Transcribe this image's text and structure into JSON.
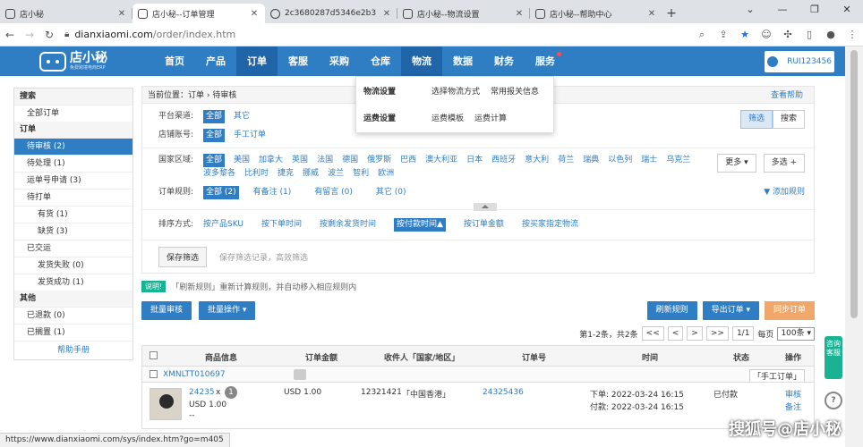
{
  "browser": {
    "tabs": [
      {
        "title": "店小秘",
        "active": false
      },
      {
        "title": "店小秘--订单管理",
        "active": true
      },
      {
        "title": "2c3680287d5346e2b3",
        "active": false
      },
      {
        "title": "店小秘--物流设置",
        "active": false
      },
      {
        "title": "店小秘--帮助中心",
        "active": false
      }
    ],
    "new_tab": "+",
    "url_host": "dianxiaomi.com",
    "url_path": "/order/index.htm",
    "status_url": "https://www.dianxiaomi.com/sys/index.htm?go=m405"
  },
  "app": {
    "logo_name": "店小秘",
    "logo_sub": "免费跨境电商ERP",
    "menu": [
      "首页",
      "产品",
      "订单",
      "客服",
      "采购",
      "仓库",
      "物流",
      "数据",
      "财务",
      "服务"
    ],
    "user": "RUI123456",
    "logistics_dropdown": {
      "rows": [
        {
          "title": "物流设置",
          "items": [
            "选择物流方式",
            "常用报关信息"
          ]
        },
        {
          "title": "运费设置",
          "items": [
            "运费模板",
            "运费计算"
          ]
        }
      ]
    }
  },
  "sidebar": {
    "search_header": "搜索",
    "all_orders": "全部订单",
    "order_header": "订单",
    "items": [
      {
        "label": "待审核  (2)",
        "selected": true,
        "sub": false
      },
      {
        "label": "待处理  (1)",
        "selected": false,
        "sub": false
      },
      {
        "label": "运单号申请  (3)",
        "selected": false,
        "sub": false
      },
      {
        "label": "待打单",
        "selected": false,
        "sub": false
      },
      {
        "label": "有货  (1)",
        "selected": false,
        "sub": true
      },
      {
        "label": "缺货  (3)",
        "selected": false,
        "sub": true
      },
      {
        "label": "已交运",
        "selected": false,
        "sub": false
      },
      {
        "label": "发货失败  (0)",
        "selected": false,
        "sub": true
      },
      {
        "label": "发货成功  (1)",
        "selected": false,
        "sub": true
      }
    ],
    "other_header": "其他",
    "other_items": [
      "已退款  (0)",
      "已搁置  (1)"
    ],
    "help": "帮助手册"
  },
  "main": {
    "breadcrumb": "当前位置：订单 › 待审核",
    "help_link": "查看帮助",
    "filters": {
      "platform_label": "平台渠道:",
      "platform_opts": [
        "全部",
        "其它"
      ],
      "shop_label": "店铺账号:",
      "shop_opts": [
        "全部",
        "手工订单"
      ],
      "country_label": "国家区域:",
      "country_opts": [
        "全部",
        "美国",
        "加拿大",
        "英国",
        "法国",
        "德国",
        "俄罗斯",
        "巴西",
        "澳大利亚",
        "日本",
        "西班牙",
        "意大利",
        "荷兰",
        "瑞典",
        "以色列",
        "瑞士",
        "乌克兰",
        "波多黎各",
        "比利时",
        "捷克",
        "挪威",
        "波兰",
        "智利",
        "欧洲"
      ],
      "rule_label": "订单规则:",
      "rule_opts": [
        "全部 (2)",
        "有备注 (1)",
        "有留言 (0)",
        "其它 (0)"
      ],
      "sort_label": "排序方式:",
      "sort_opts": [
        "按产品SKU",
        "按下单时间",
        "按剩余发货时间",
        "按付款时间▲",
        "按订单金额",
        "按买家指定物流"
      ],
      "filter_btn": "筛选",
      "search_btn": "搜索",
      "more_btn": "更多 ▾",
      "multi_btn": "多选 +",
      "add_rule": "▼ 添加规则",
      "save_btn": "保存筛选",
      "save_hint": "保存筛选记录，高效筛选"
    },
    "tip_tag": "说明!",
    "tip_text": "「刷新规则」重新计算规则，并自动移入相应规则内",
    "actions": {
      "batch_review": "批量审核",
      "batch_ops": "批量操作 ▾",
      "refresh": "刷新规则",
      "export": "导出订单 ▾",
      "sync": "同步订单"
    },
    "pager": {
      "summary": "第1-2条，共2条",
      "first": "<<",
      "prev": "<",
      "next": ">",
      "last": ">>",
      "page": "1/1",
      "per_label": "每页",
      "per": "100条 ▾"
    },
    "table": {
      "headers": [
        "商品信息",
        "订单金额",
        "收件人「国家/地区」",
        "订单号",
        "时间",
        "状态",
        "操作"
      ],
      "group_id": "XMNLTT010697",
      "group_tag": "「手工订单」",
      "row": {
        "sku": "24235",
        "qty": "x",
        "qty_badge": "1",
        "price": "USD 1.00",
        "dash": "--",
        "amount": "USD 1.00",
        "recipient": "12321421",
        "country": "「中国香港」",
        "order_no": "24325436",
        "order_time": "下单: 2022-03-24 16:15",
        "pay_time": "付款: 2022-03-24 16:15",
        "status": "已付款",
        "op1": "审核",
        "op2": "备注"
      }
    }
  },
  "floating": {
    "consult": "咨询客服",
    "question": "?"
  },
  "watermark": "搜狐号@店小秘"
}
